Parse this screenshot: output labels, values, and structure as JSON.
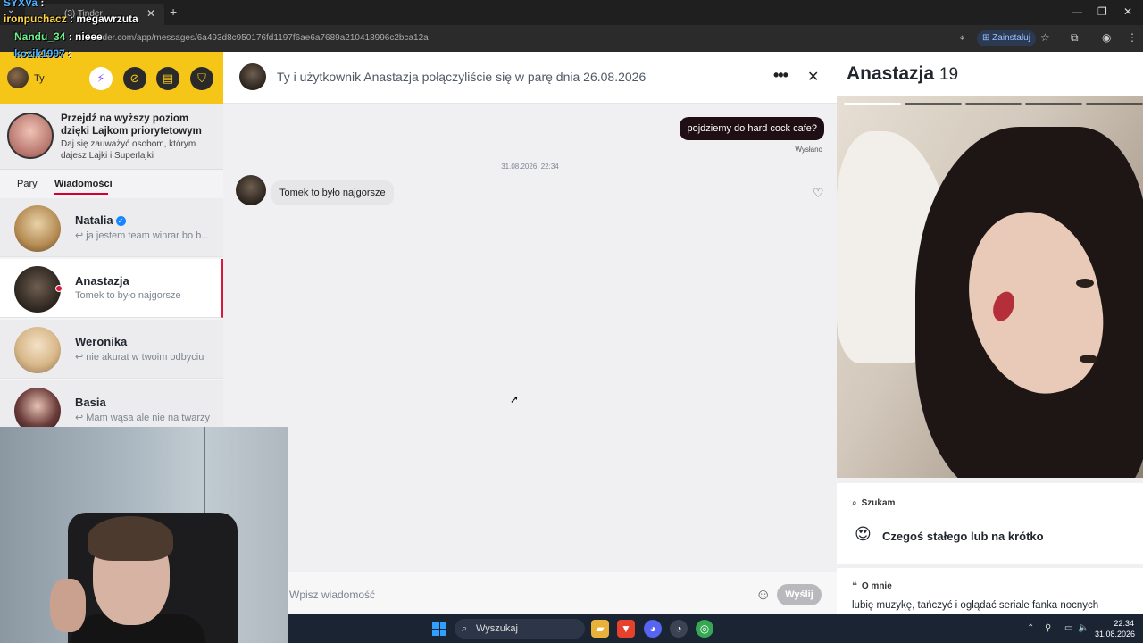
{
  "browser": {
    "tab_title": "(3) Tinder",
    "url": "tinder.com/app/messages/6a493d8c950176fd1197f6ae6a7689a210418996c2bca12a",
    "install_label": "Zainstaluj"
  },
  "stream_chat": [
    {
      "user": "SYXVa",
      "msg": ""
    },
    {
      "user": "ironpuchacz",
      "msg": "megawrzuta"
    },
    {
      "user": "Nandu_34",
      "msg": "nieee"
    },
    {
      "user": "kozik1997",
      "msg": ""
    }
  ],
  "sidebar": {
    "me_label": "Ty",
    "promo_title": "Przejdź na wyższy poziom dzięki Lajkom priorytetowym",
    "promo_sub": "Daj się zauważyć osobom, którym dajesz Lajki i Superlajki",
    "tab_pairs": "Pary",
    "tab_messages": "Wiadomości",
    "conversations": [
      {
        "name": "Natalia",
        "preview": "↩ ja jestem team winrar bo b...",
        "verified": true
      },
      {
        "name": "Anastazja",
        "preview": "Tomek to było najgorsze",
        "verified": false
      },
      {
        "name": "Weronika",
        "preview": "↩ nie akurat w twoim odbyciu",
        "verified": false
      },
      {
        "name": "Basia",
        "preview": "↩ Mam wąsa ale nie na twarzy",
        "verified": false
      }
    ]
  },
  "chat": {
    "header_title": "Ty i użytkownik Anastazja połączyliście się w parę dnia 26.08.2026",
    "outgoing_message": "pojdziemy do hard cock cafe?",
    "sent_status": "Wysłano",
    "timestamp": "31.08.2026, 22:34",
    "incoming_message": "Tomek to było najgorsze",
    "composer_placeholder": "Wpisz wiadomość",
    "send_label": "Wyślij"
  },
  "profile": {
    "name": "Anastazja",
    "age": "19",
    "looking_title": "Szukam",
    "looking_value": "Czegoś stałego lub na krótko",
    "looking_emoji": "😍",
    "about_title": "O mnie",
    "about_text": "lubię muzykę, tańczyć i oglądać seriale fanka nocnych"
  },
  "taskbar": {
    "search_label": "Wyszukaj",
    "time": "22:34",
    "date": "31.08.2026"
  },
  "colors": {
    "accent_yellow": "#f5c518",
    "brand_red": "#d81b3a",
    "outgoing_bubble": "#1f0e14"
  }
}
